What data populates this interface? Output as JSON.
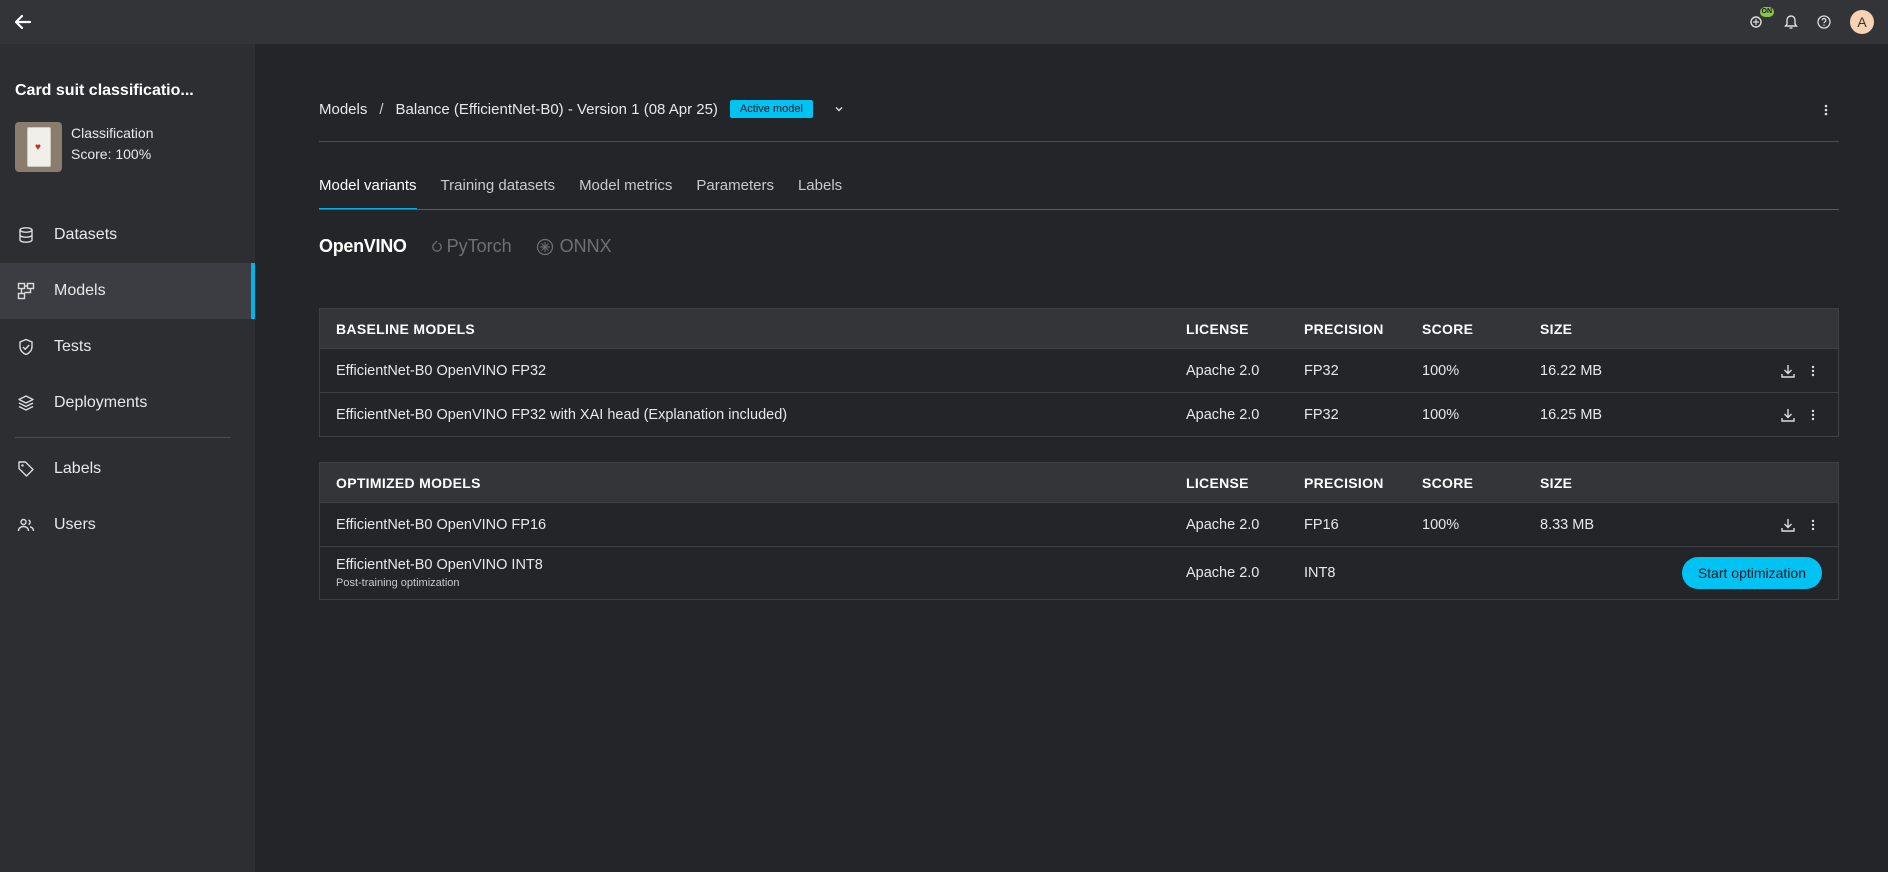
{
  "topbar": {
    "status_badge": "ON",
    "avatar_initial": "A"
  },
  "project": {
    "title": "Card suit classificatio...",
    "type": "Classification",
    "score": "Score: 100%"
  },
  "nav": {
    "datasets": "Datasets",
    "models": "Models",
    "tests": "Tests",
    "deployments": "Deployments",
    "labels": "Labels",
    "users": "Users"
  },
  "breadcrumb": {
    "root": "Models",
    "separator": "/",
    "current": "Balance (EfficientNet-B0) - Version 1 (08 Apr 25)",
    "badge": "Active model"
  },
  "tabs": [
    "Model variants",
    "Training datasets",
    "Model metrics",
    "Parameters",
    "Labels"
  ],
  "frameworks": {
    "openvino": "OpenVINO",
    "pytorch": "PyTorch",
    "onnx": "ONNX"
  },
  "columns": {
    "license": "LICENSE",
    "precision": "PRECISION",
    "score": "SCORE",
    "size": "SIZE"
  },
  "baseline": {
    "header": "BASELINE MODELS",
    "rows": [
      {
        "name": "EfficientNet-B0 OpenVINO FP32",
        "license": "Apache 2.0",
        "precision": "FP32",
        "score": "100%",
        "size": "16.22 MB"
      },
      {
        "name": "EfficientNet-B0 OpenVINO FP32 with XAI head (Explanation included)",
        "license": "Apache 2.0",
        "precision": "FP32",
        "score": "100%",
        "size": "16.25 MB"
      }
    ]
  },
  "optimized": {
    "header": "OPTIMIZED MODELS",
    "rows": [
      {
        "name": "EfficientNet-B0 OpenVINO FP16",
        "license": "Apache 2.0",
        "precision": "FP16",
        "score": "100%",
        "size": "8.33 MB"
      },
      {
        "name": "EfficientNet-B0 OpenVINO INT8",
        "subtitle": "Post-training optimization",
        "license": "Apache 2.0",
        "precision": "INT8",
        "action": "Start optimization"
      }
    ]
  },
  "colors": {
    "accent": "#00c2f3",
    "background": "#242528",
    "sidebar": "#2d2e32",
    "topbar": "#323438"
  }
}
